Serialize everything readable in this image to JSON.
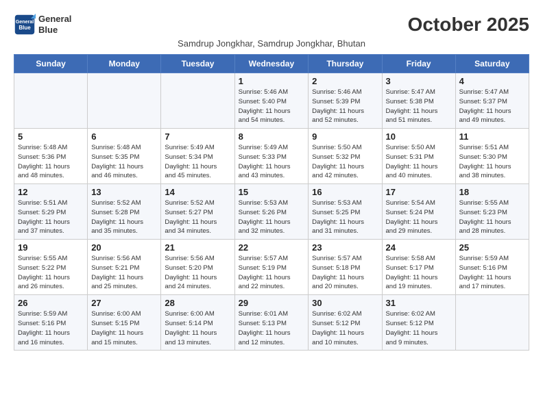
{
  "header": {
    "logo_line1": "General",
    "logo_line2": "Blue",
    "month_title": "October 2025",
    "subtitle": "Samdrup Jongkhar, Samdrup Jongkhar, Bhutan"
  },
  "weekdays": [
    "Sunday",
    "Monday",
    "Tuesday",
    "Wednesday",
    "Thursday",
    "Friday",
    "Saturday"
  ],
  "weeks": [
    [
      {
        "day": "",
        "info": ""
      },
      {
        "day": "",
        "info": ""
      },
      {
        "day": "",
        "info": ""
      },
      {
        "day": "1",
        "info": "Sunrise: 5:46 AM\nSunset: 5:40 PM\nDaylight: 11 hours\nand 54 minutes."
      },
      {
        "day": "2",
        "info": "Sunrise: 5:46 AM\nSunset: 5:39 PM\nDaylight: 11 hours\nand 52 minutes."
      },
      {
        "day": "3",
        "info": "Sunrise: 5:47 AM\nSunset: 5:38 PM\nDaylight: 11 hours\nand 51 minutes."
      },
      {
        "day": "4",
        "info": "Sunrise: 5:47 AM\nSunset: 5:37 PM\nDaylight: 11 hours\nand 49 minutes."
      }
    ],
    [
      {
        "day": "5",
        "info": "Sunrise: 5:48 AM\nSunset: 5:36 PM\nDaylight: 11 hours\nand 48 minutes."
      },
      {
        "day": "6",
        "info": "Sunrise: 5:48 AM\nSunset: 5:35 PM\nDaylight: 11 hours\nand 46 minutes."
      },
      {
        "day": "7",
        "info": "Sunrise: 5:49 AM\nSunset: 5:34 PM\nDaylight: 11 hours\nand 45 minutes."
      },
      {
        "day": "8",
        "info": "Sunrise: 5:49 AM\nSunset: 5:33 PM\nDaylight: 11 hours\nand 43 minutes."
      },
      {
        "day": "9",
        "info": "Sunrise: 5:50 AM\nSunset: 5:32 PM\nDaylight: 11 hours\nand 42 minutes."
      },
      {
        "day": "10",
        "info": "Sunrise: 5:50 AM\nSunset: 5:31 PM\nDaylight: 11 hours\nand 40 minutes."
      },
      {
        "day": "11",
        "info": "Sunrise: 5:51 AM\nSunset: 5:30 PM\nDaylight: 11 hours\nand 38 minutes."
      }
    ],
    [
      {
        "day": "12",
        "info": "Sunrise: 5:51 AM\nSunset: 5:29 PM\nDaylight: 11 hours\nand 37 minutes."
      },
      {
        "day": "13",
        "info": "Sunrise: 5:52 AM\nSunset: 5:28 PM\nDaylight: 11 hours\nand 35 minutes."
      },
      {
        "day": "14",
        "info": "Sunrise: 5:52 AM\nSunset: 5:27 PM\nDaylight: 11 hours\nand 34 minutes."
      },
      {
        "day": "15",
        "info": "Sunrise: 5:53 AM\nSunset: 5:26 PM\nDaylight: 11 hours\nand 32 minutes."
      },
      {
        "day": "16",
        "info": "Sunrise: 5:53 AM\nSunset: 5:25 PM\nDaylight: 11 hours\nand 31 minutes."
      },
      {
        "day": "17",
        "info": "Sunrise: 5:54 AM\nSunset: 5:24 PM\nDaylight: 11 hours\nand 29 minutes."
      },
      {
        "day": "18",
        "info": "Sunrise: 5:55 AM\nSunset: 5:23 PM\nDaylight: 11 hours\nand 28 minutes."
      }
    ],
    [
      {
        "day": "19",
        "info": "Sunrise: 5:55 AM\nSunset: 5:22 PM\nDaylight: 11 hours\nand 26 minutes."
      },
      {
        "day": "20",
        "info": "Sunrise: 5:56 AM\nSunset: 5:21 PM\nDaylight: 11 hours\nand 25 minutes."
      },
      {
        "day": "21",
        "info": "Sunrise: 5:56 AM\nSunset: 5:20 PM\nDaylight: 11 hours\nand 24 minutes."
      },
      {
        "day": "22",
        "info": "Sunrise: 5:57 AM\nSunset: 5:19 PM\nDaylight: 11 hours\nand 22 minutes."
      },
      {
        "day": "23",
        "info": "Sunrise: 5:57 AM\nSunset: 5:18 PM\nDaylight: 11 hours\nand 20 minutes."
      },
      {
        "day": "24",
        "info": "Sunrise: 5:58 AM\nSunset: 5:17 PM\nDaylight: 11 hours\nand 19 minutes."
      },
      {
        "day": "25",
        "info": "Sunrise: 5:59 AM\nSunset: 5:16 PM\nDaylight: 11 hours\nand 17 minutes."
      }
    ],
    [
      {
        "day": "26",
        "info": "Sunrise: 5:59 AM\nSunset: 5:16 PM\nDaylight: 11 hours\nand 16 minutes."
      },
      {
        "day": "27",
        "info": "Sunrise: 6:00 AM\nSunset: 5:15 PM\nDaylight: 11 hours\nand 15 minutes."
      },
      {
        "day": "28",
        "info": "Sunrise: 6:00 AM\nSunset: 5:14 PM\nDaylight: 11 hours\nand 13 minutes."
      },
      {
        "day": "29",
        "info": "Sunrise: 6:01 AM\nSunset: 5:13 PM\nDaylight: 11 hours\nand 12 minutes."
      },
      {
        "day": "30",
        "info": "Sunrise: 6:02 AM\nSunset: 5:12 PM\nDaylight: 11 hours\nand 10 minutes."
      },
      {
        "day": "31",
        "info": "Sunrise: 6:02 AM\nSunset: 5:12 PM\nDaylight: 11 hours\nand 9 minutes."
      },
      {
        "day": "",
        "info": ""
      }
    ]
  ]
}
